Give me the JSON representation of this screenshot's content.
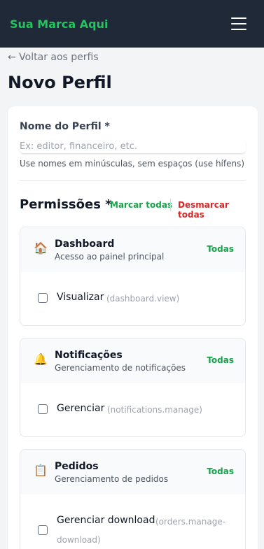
{
  "app": {
    "brand": "Sua Marca Aqui"
  },
  "nav": {
    "back_label": "← Voltar aos perfis"
  },
  "page": {
    "title": "Novo Perfil"
  },
  "form": {
    "name_label": "Nome do Perfil *",
    "name_placeholder": "Ex: editor, financeiro, etc.",
    "name_value": "",
    "name_help": "Use nomes em minúsculas, sem espaços (use hífens)"
  },
  "permissions": {
    "title": "Permissões *",
    "mark_all": "Marcar todas",
    "unmark_all": "Desmarcar todas",
    "groups": [
      {
        "icon": "house-icon",
        "emoji": "🏠",
        "name": "Dashboard",
        "description": "Acesso ao painel principal",
        "all_label": "Todas",
        "items": [
          {
            "label": "Visualizar",
            "code": "(dashboard.view)",
            "checked": false
          }
        ]
      },
      {
        "icon": "bell-icon",
        "emoji": "🔔",
        "name": "Notificações",
        "description": "Gerenciamento de notificações",
        "all_label": "Todas",
        "items": [
          {
            "label": "Gerenciar",
            "code": "(notifications.manage)",
            "checked": false
          }
        ]
      },
      {
        "icon": "clipboard-icon",
        "emoji": "📋",
        "name": "Pedidos",
        "description": "Gerenciamento de pedidos",
        "all_label": "Todas",
        "items": [
          {
            "label": "Gerenciar download",
            "code": "(orders.manage-download)",
            "code_line1": "(orders.manage-",
            "code_line2": "download)",
            "checked": false
          }
        ]
      }
    ]
  },
  "colors": {
    "brand": "#22c55e",
    "topbar": "#1f2937",
    "accent_green": "#16a34a",
    "danger_red": "#dc2626"
  }
}
